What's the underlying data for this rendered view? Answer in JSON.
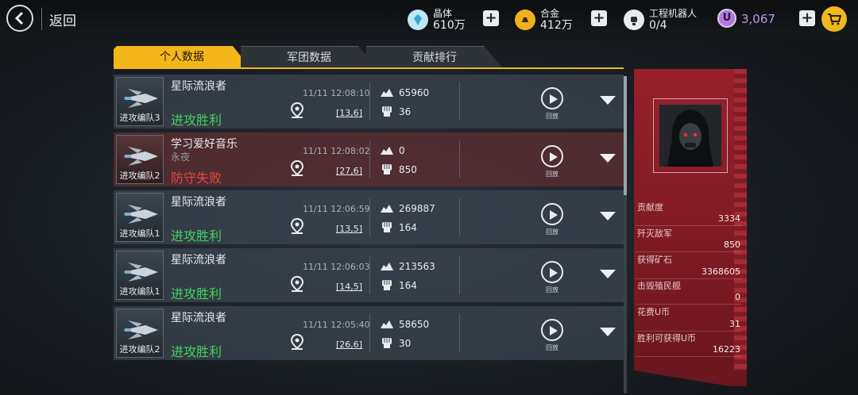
{
  "header": {
    "back_label": "返回",
    "crystal": {
      "label": "晶体",
      "value": "610万"
    },
    "alloy": {
      "label": "合金",
      "value": "412万"
    },
    "robot": {
      "label": "工程机器人",
      "value": "0/4"
    },
    "ucoin": {
      "symbol": "U",
      "value": "3,067"
    },
    "plus": "+"
  },
  "tabs": [
    {
      "label": "个人数据",
      "active": true
    },
    {
      "label": "军团数据",
      "active": false
    },
    {
      "label": "贡献排行",
      "active": false
    }
  ],
  "battles": [
    {
      "name": "星际流浪者",
      "sub": "",
      "fleet": "进攻编队3",
      "result": "进攻胜利",
      "outcome": "win",
      "time": "11/11 12:08:10",
      "coord": "[13,6]",
      "mine": "65960",
      "kills": "36",
      "replay": "回放"
    },
    {
      "name": "学习爱好音乐",
      "sub": "永夜",
      "fleet": "进攻编队2",
      "result": "防守失败",
      "outcome": "loss",
      "time": "11/11 12:08:02",
      "coord": "[27,6]",
      "mine": "0",
      "kills": "850",
      "replay": "回放"
    },
    {
      "name": "星际流浪者",
      "sub": "",
      "fleet": "进攻编队1",
      "result": "进攻胜利",
      "outcome": "win",
      "time": "11/11 12:06:59",
      "coord": "[13,5]",
      "mine": "269887",
      "kills": "164",
      "replay": "回放"
    },
    {
      "name": "星际流浪者",
      "sub": "",
      "fleet": "进攻编队1",
      "result": "进攻胜利",
      "outcome": "win",
      "time": "11/11 12:06:03",
      "coord": "[14,5]",
      "mine": "213563",
      "kills": "164",
      "replay": "回放"
    },
    {
      "name": "星际流浪者",
      "sub": "",
      "fleet": "进攻编队2",
      "result": "进攻胜利",
      "outcome": "win",
      "time": "11/11 12:05:40",
      "coord": "[26,6]",
      "mine": "58650",
      "kills": "30",
      "replay": "回放"
    }
  ],
  "stats": [
    {
      "label": "贡献度",
      "value": "3334"
    },
    {
      "label": "歼灭敌军",
      "value": "850"
    },
    {
      "label": "获得矿石",
      "value": "3368605"
    },
    {
      "label": "击毁殖民舰",
      "value": "0"
    },
    {
      "label": "花费U币",
      "value": "31"
    },
    {
      "label": "胜利可获得U币",
      "value": "16223"
    }
  ],
  "colors": {
    "accent": "#f3b71a",
    "win": "#41d25e",
    "loss": "#e24a42",
    "panel": "#8c1e29",
    "ucoin": "#c592f0"
  }
}
